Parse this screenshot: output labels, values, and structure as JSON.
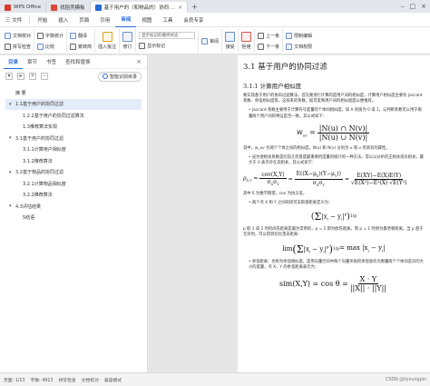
{
  "tabs": {
    "home": "WPS Office",
    "t1": "找稻壳模板",
    "t2": "基于用户的（和物品的）协同 ..."
  },
  "menu": {
    "file": "三 文件",
    "items": [
      "开始",
      "插入",
      "页面",
      "引用",
      "审阅",
      "视图",
      "工具",
      "会员专享"
    ],
    "active": "审阅"
  },
  "ribbon": {
    "doc_check": "文档校对",
    "spell": "拼写检查",
    "count": "字数统计",
    "compare": "比较",
    "translate": "翻译",
    "simp_trad": "繁转简",
    "insert_comment": "插入批注",
    "track": "修订",
    "show_markup": "显示标记的最终状态",
    "show_markup2": "显示标记",
    "review": "审阅",
    "accept": "接受",
    "reject": "拒绝",
    "prev": "上一条",
    "next": "下一条",
    "restrict": "限制编辑",
    "protect": "文档权限"
  },
  "sidebar": {
    "tabs": [
      "目录",
      "章节",
      "书签",
      "查找和替换"
    ],
    "smart_toc": "智能识别目录",
    "items": [
      {
        "label": "摘 要",
        "level": 1,
        "caret": "",
        "selected": false
      },
      {
        "label": "1.1基于用户的协同过滤",
        "level": 1,
        "caret": "▾",
        "selected": true
      },
      {
        "label": "1.2.2基于用户的协同过滤算法",
        "level": 2,
        "caret": "",
        "selected": false
      },
      {
        "label": "1.3推荐算法实现",
        "level": 2,
        "caret": "",
        "selected": false
      },
      {
        "label": "3.1基于用户的协同过滤",
        "level": 1,
        "caret": "▾",
        "selected": false
      },
      {
        "label": "3.1.1计算用户相似度",
        "level": 2,
        "caret": "",
        "selected": false
      },
      {
        "label": "3.1.2推荐算法",
        "level": 2,
        "caret": "",
        "selected": false
      },
      {
        "label": "3.2基于物品的协同过滤",
        "level": 1,
        "caret": "▾",
        "selected": false
      },
      {
        "label": "3.2.1计算物品相似度",
        "level": 2,
        "caret": "",
        "selected": false
      },
      {
        "label": "3.2.2推荐算法",
        "level": 2,
        "caret": "",
        "selected": false
      },
      {
        "label": "4.3评估结果",
        "level": 1,
        "caret": "▾",
        "selected": false
      },
      {
        "label": "5结语",
        "level": 2,
        "caret": "",
        "selected": false
      }
    ]
  },
  "doc": {
    "title": "3.1 基于用户的协同过滤",
    "subtitle": "3.1.1 计算用户相似度",
    "p1": "要实现基于用户的协同过滤算法，首先要进行计算的是用户间的相似度，计算用户相似度主要有 Jaccard 系数、余弦相似度等，这样来的系数，既可反映用户间的相似程度以便推荐。",
    "b1": "• Jaccard 系数主要用于计算符号度量的个体间相似度，如 A 的值为 0 或 1，与判断系数可以用于衡量两个用户间的特征是否一致，其公式如下：",
    "f1": "w_uv = |N(u) ∩ N(v)| / |N(u) ∪ N(v)|",
    "p2": "其中，w_uv 为两个个体之间的相似度，N(u) 和 N(v) 分别为 u 和 v 所具有的属性。",
    "b2": "• 皮尔逊相关系数是比较几何意度最重要的度量的统计的一种方法，常以以分析的正相关或负相关，最大于 0 表示存在其相关，其公式如下：",
    "f2": "ρX,Y = cov(X,Y)/σXσY = E((X−μX)(Y−μY))/σXσY = E(XY)−E(X)E(Y) / √E(X²)−E²(X) √E(Y²)−E²(Y)",
    "p3": "其中 E 为数学期望，cov 为协方差。",
    "b3": "• 两个点 X 和 Y 之间的闵可夫斯基距离定义为：",
    "f3": "(Σ |xi − yi|^p)^(1/p)",
    "p4": "p 取 1 或 2 时的闵氏距离是最为常用的，p = 2 即为欧氏距离，而 p = 1 时则为曼哈顿距离。当 p 趋于无穷时，可以得到切比雪夫距离：",
    "f4": "lim (Σ |xi − yi|^p)^(1/p) = max |xi − yi|",
    "b4": "• 余弦距离：也称为余弦相似度，是用向量空间中两个向量夹角的余弦值作为衡量两个个体间差异的大小的度量，点 X、Y 的余弦距离表示为：",
    "f5": "sim(X,Y) = cosθ = X·Y / ||X||·||Y||"
  },
  "status": {
    "page": "页面: 1/13",
    "words": "字数: 4913",
    "spell": "拼写检查",
    "doc_check": "文档校对",
    "compat": "兼容模式",
    "watermark": "CSDN @liyoungpin"
  }
}
